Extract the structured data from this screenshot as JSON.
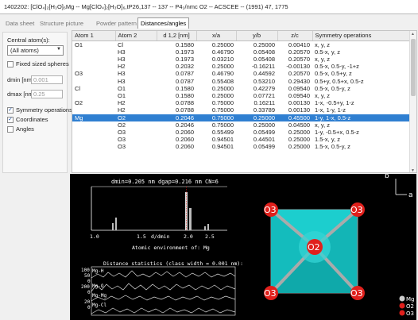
{
  "window": {
    "title": "1402202:  [ClO₄]₂[H₃O]₆Mg  --  Mg[ClO₄]₂[H₃O]₆,tP26,137  --  137  --  P4₂/nmc O2  --  ACSCEE  --  (1991) 47, 1775"
  },
  "tabs": [
    "Data sheet",
    "Structure picture",
    "Powder pattern",
    "Distances/angles"
  ],
  "left_panel": {
    "central_atoms_label": "Central atom(s):",
    "central_atoms_value": "(All atoms)",
    "fixed_spheres_label": "Fixed sized spheres",
    "dmin_label": "dmin [nm]:",
    "dmin_value": "0.001",
    "dmax_label": "dmax [nm]:",
    "dmax_value": "0.25",
    "symmetry_label": "Symmetry operations",
    "coordinates_label": "Coordinates",
    "angles_label": "Angles"
  },
  "table": {
    "headers": [
      "Atom 1",
      "Atom 2",
      "d 1,2 [nm]",
      "x/a",
      "y/b",
      "z/c",
      "Symmetry operations"
    ],
    "rows": [
      [
        "O1",
        "Cl",
        "0.1580",
        "0.25000",
        "0.25000",
        "0.00410",
        "x, y, z"
      ],
      [
        "",
        "H3",
        "0.1973",
        "0.46790",
        "0.05408",
        "0.20570",
        "0.5-x, y, z"
      ],
      [
        "",
        "H3",
        "0.1973",
        "0.03210",
        "0.05408",
        "0.20570",
        "x, y, z"
      ],
      [
        "",
        "H2",
        "0.2032",
        "0.25000",
        "-0.16211",
        "-0.00130",
        "0.5-x, 0.5-y, -1+z"
      ],
      [
        "O3",
        "H3",
        "0.0787",
        "0.46790",
        "0.44592",
        "0.20570",
        "0.5-x, 0.5+y, z"
      ],
      [
        "",
        "H3",
        "0.0787",
        "0.55408",
        "0.53210",
        "0.29430",
        "0.5+y, 0.5+x, 0.5-z"
      ],
      [
        "Cl",
        "O1",
        "0.1580",
        "0.25000",
        "0.42279",
        "0.09540",
        "0.5-x, 0.5-y, z"
      ],
      [
        "",
        "O1",
        "0.1580",
        "0.25000",
        "0.07721",
        "0.09540",
        "x, y, z"
      ],
      [
        "O2",
        "H2",
        "0.0788",
        "0.75000",
        "0.16211",
        "0.00130",
        "1-x, -0.5+y, 1-z"
      ],
      [
        "",
        "H2",
        "0.0788",
        "0.75000",
        "0.33789",
        "0.00130",
        "1-x, 1-y, 1-z"
      ],
      [
        "Mg",
        "O2",
        "0.2046",
        "0.75000",
        "0.25000",
        "0.45500",
        "1-y, 1-x, 0.5-z"
      ],
      [
        "",
        "O2",
        "0.2046",
        "0.75000",
        "0.25000",
        "0.04500",
        "x, y, z"
      ],
      [
        "",
        "O3",
        "0.2060",
        "0.55499",
        "0.05499",
        "0.25000",
        "1-y, -0.5+x, 0.5-z"
      ],
      [
        "",
        "O3",
        "0.2060",
        "0.94501",
        "0.44501",
        "0.25000",
        "1.5-x, y, z"
      ],
      [
        "",
        "O3",
        "0.2060",
        "0.94501",
        "0.05499",
        "0.25000",
        "1.5-x, 0.5-y, z"
      ]
    ]
  },
  "histogram": {
    "header": "dmin=0.205 nm  dgap=0.216 nm  CN=6",
    "caption": "Atomic environment of: Mg",
    "x_tick_labels": [
      "1.0",
      "1.5",
      "2.0",
      "2.5"
    ],
    "x_label": "d/dmin"
  },
  "stats": {
    "header": "Distance statistics (class width = 0.001 nm):",
    "y_tick_labels": [
      "100",
      "50",
      "0",
      "200",
      "0",
      "20",
      "0"
    ],
    "x_tick_labels": [
      "1.0",
      "1.5",
      "2.0",
      "2.5"
    ],
    "x_label": "d/dmin",
    "pair_labels": [
      "Mg-H",
      "Mg-O",
      "Mg-Mg",
      "Mg-Cl"
    ]
  },
  "structure": {
    "axis_b": "b",
    "axis_a": "a",
    "atom_label": "O3",
    "center_label": "O2",
    "legend": [
      "Mg",
      "O2",
      "O3"
    ],
    "colors": {
      "atom_red": "#e0201c",
      "octahedron": "#17c5c6",
      "selection": "#2f7fd1"
    }
  }
}
